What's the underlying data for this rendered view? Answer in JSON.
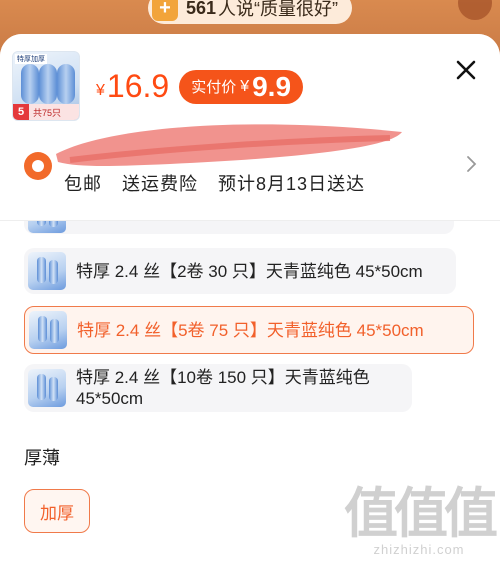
{
  "background": {
    "review_count": "561",
    "review_text": "人说“质量很好”"
  },
  "product": {
    "thumb_count": "5",
    "thumb_pieces": "共75只",
    "currency": "¥",
    "original_price": "16.9",
    "pay_label": "实付价",
    "pay_price": "9.9"
  },
  "shipping": {
    "free_shipping": "包邮",
    "insurance": "送运费险",
    "eta": "预计8月13日送达"
  },
  "options": [
    {
      "label": "特厚 2.4 丝【2卷 30 只】天青蓝纯色 45*50cm",
      "selected": false
    },
    {
      "label": "特厚 2.4 丝【5卷 75 只】天青蓝纯色 45*50cm",
      "selected": true
    },
    {
      "label": "特厚 2.4 丝【10卷 150 只】天青蓝纯色 45*50cm",
      "selected": false
    }
  ],
  "thickness": {
    "title": "厚薄",
    "option": "加厚"
  },
  "watermark": {
    "logo": "值值值",
    "url": "zhizhizhi.com"
  },
  "colors": {
    "accent": "#f5541a",
    "price": "#ff4a12"
  }
}
